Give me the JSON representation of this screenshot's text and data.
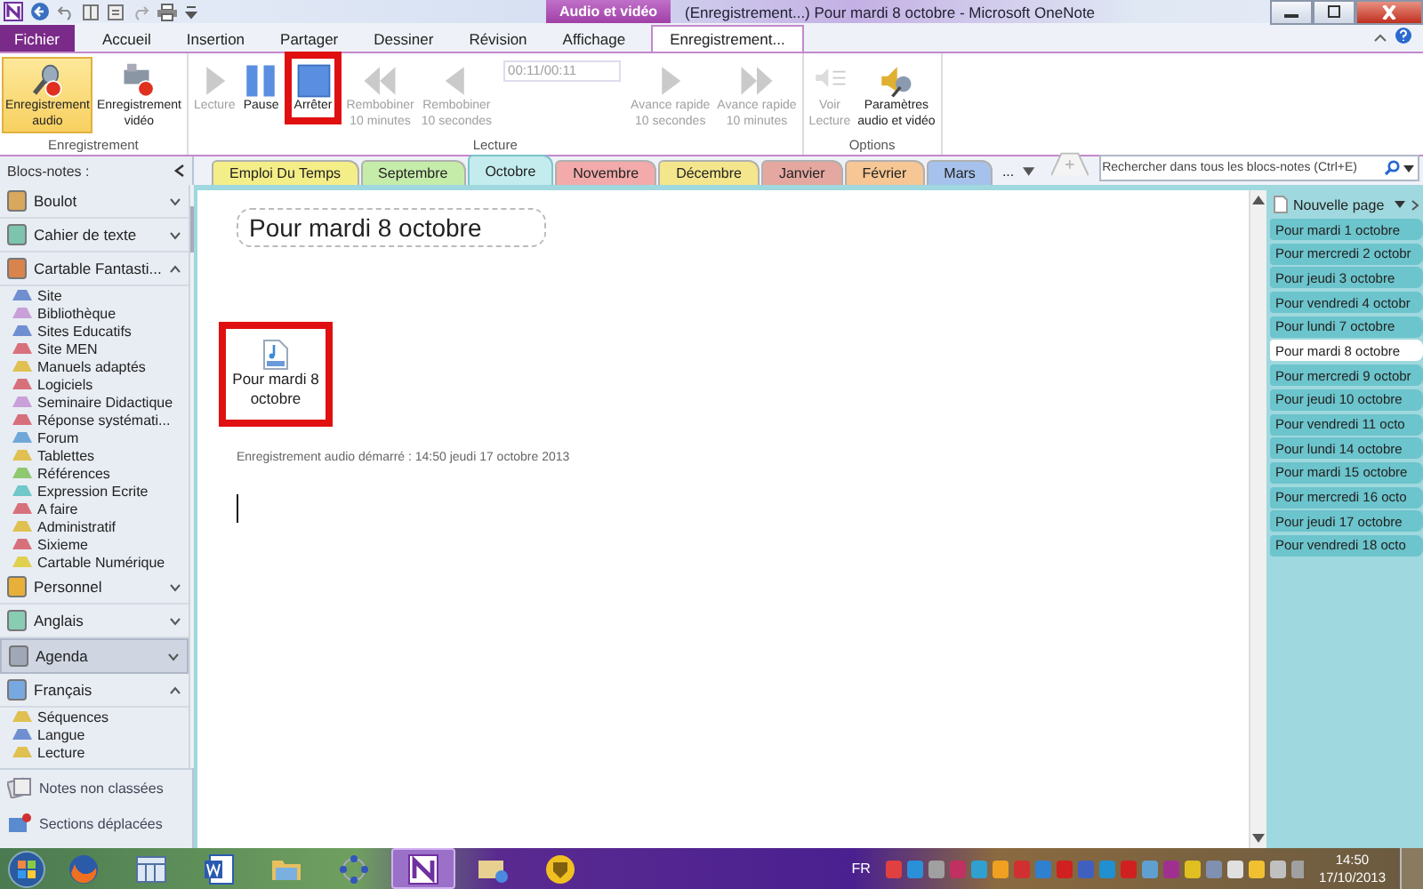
{
  "window": {
    "title": "(Enregistrement...) Pour mardi 8 octobre  -  Microsoft OneNote",
    "context_label": "Audio et vidéo"
  },
  "ribbon_tabs": [
    {
      "label": "Fichier",
      "kind": "file",
      "selected": false
    },
    {
      "label": "Accueil",
      "kind": "tab",
      "selected": false
    },
    {
      "label": "Insertion",
      "kind": "tab",
      "selected": false
    },
    {
      "label": "Partager",
      "kind": "tab",
      "selected": false
    },
    {
      "label": "Dessiner",
      "kind": "tab",
      "selected": false
    },
    {
      "label": "Révision",
      "kind": "tab",
      "selected": false
    },
    {
      "label": "Affichage",
      "kind": "tab",
      "selected": false
    },
    {
      "label": "Enregistrement...",
      "kind": "context",
      "selected": true
    }
  ],
  "ribbon_groups": [
    {
      "label": "Enregistrement",
      "buttons": [
        {
          "kind": "record-audio",
          "lines": [
            "Enregistrement",
            "audio"
          ],
          "disabled": false,
          "selected": true,
          "highlighted": false
        },
        {
          "kind": "record-video",
          "lines": [
            "Enregistrement",
            "vidéo"
          ],
          "disabled": false,
          "selected": false,
          "highlighted": false
        }
      ]
    },
    {
      "label": "Lecture",
      "time": "00:11/00:11",
      "buttons": [
        {
          "kind": "play",
          "lines": [
            "Lecture"
          ],
          "disabled": true,
          "selected": false,
          "highlighted": false
        },
        {
          "kind": "pause",
          "lines": [
            "Pause"
          ],
          "disabled": false,
          "selected": false,
          "highlighted": false
        },
        {
          "kind": "stop",
          "lines": [
            "Arrêter"
          ],
          "disabled": false,
          "selected": false,
          "highlighted": true
        },
        {
          "kind": "rewind-fast",
          "lines": [
            "Rembobiner",
            "10 minutes"
          ],
          "disabled": true,
          "selected": false,
          "highlighted": false
        },
        {
          "kind": "rewind",
          "lines": [
            "Rembobiner",
            "10 secondes"
          ],
          "disabled": true,
          "selected": false,
          "highlighted": false
        },
        {
          "kind": "time"
        },
        {
          "kind": "forward",
          "lines": [
            "Avance rapide",
            "10 secondes"
          ],
          "disabled": true,
          "selected": false,
          "highlighted": false
        },
        {
          "kind": "forward-fast",
          "lines": [
            "Avance rapide",
            "10 minutes"
          ],
          "disabled": true,
          "selected": false,
          "highlighted": false
        }
      ]
    },
    {
      "label": "Options",
      "buttons": [
        {
          "kind": "view",
          "lines": [
            "Voir",
            "Lecture"
          ],
          "disabled": true,
          "selected": false,
          "highlighted": false
        },
        {
          "kind": "settings",
          "lines": [
            "Paramètres",
            "audio et vidéo"
          ],
          "disabled": false,
          "selected": false,
          "highlighted": false
        }
      ]
    }
  ],
  "sidebar": {
    "title": "Blocs-notes :",
    "notebooks": [
      {
        "name": "Boulot",
        "color": "#d8a85c",
        "expanded": false,
        "selected": false
      },
      {
        "name": "Cahier de texte",
        "color": "#7cc4ae",
        "expanded": false,
        "selected": false
      },
      {
        "name": "Cartable Fantasti...",
        "color": "#d9844c",
        "expanded": true,
        "selected": false,
        "sections": [
          {
            "name": "Site",
            "color": "#6f8fd0"
          },
          {
            "name": "Bibliothèque",
            "color": "#c9a0d8"
          },
          {
            "name": "Sites Educatifs",
            "color": "#6f8fd0"
          },
          {
            "name": "Site MEN",
            "color": "#d8707c"
          },
          {
            "name": "Manuels adaptés",
            "color": "#e0c050"
          },
          {
            "name": "Logiciels",
            "color": "#d8707c"
          },
          {
            "name": "Seminaire Didactique",
            "color": "#c9a0d8"
          },
          {
            "name": "Réponse systémati...",
            "color": "#d8707c"
          },
          {
            "name": "Forum",
            "color": "#6fa8d8"
          },
          {
            "name": "Tablettes",
            "color": "#e0c050"
          },
          {
            "name": "Références",
            "color": "#90c870"
          },
          {
            "name": "Expression Ecrite",
            "color": "#70c8c8"
          },
          {
            "name": "A faire",
            "color": "#d8707c"
          },
          {
            "name": "Administratif",
            "color": "#e0c050"
          },
          {
            "name": "Sixieme",
            "color": "#d8707c"
          },
          {
            "name": "Cartable Numérique",
            "color": "#e0d050"
          }
        ]
      },
      {
        "name": "Personnel",
        "color": "#e8b038",
        "expanded": false,
        "selected": false
      },
      {
        "name": "Anglais",
        "color": "#88ccb4",
        "expanded": false,
        "selected": false
      },
      {
        "name": "Agenda",
        "color": "#a0a8b8",
        "expanded": false,
        "selected": true
      },
      {
        "name": "Français",
        "color": "#78a8e0",
        "expanded": true,
        "selected": false,
        "sections": [
          {
            "name": "Séquences",
            "color": "#e0c050"
          },
          {
            "name": "Langue",
            "color": "#6f8fd0"
          },
          {
            "name": "Lecture",
            "color": "#e0c050"
          }
        ]
      }
    ],
    "footer": [
      {
        "label": "Notes non classées",
        "kind": "unfiled"
      },
      {
        "label": "Sections déplacées",
        "kind": "misplaced"
      }
    ]
  },
  "section_tabs": [
    {
      "label": "Emploi Du Temps",
      "color": "#f4ee88",
      "selected": false
    },
    {
      "label": "Septembre",
      "color": "#c6ecaa",
      "selected": false
    },
    {
      "label": "Octobre",
      "color": "#c4ecee",
      "selected": true
    },
    {
      "label": "Novembre",
      "color": "#f2aaaa",
      "selected": false
    },
    {
      "label": "Décembre",
      "color": "#f4e68c",
      "selected": false
    },
    {
      "label": "Janvier",
      "color": "#e4a8a0",
      "selected": false
    },
    {
      "label": "Février",
      "color": "#f6c694",
      "selected": false
    },
    {
      "label": "Mars",
      "color": "#a6c2ec",
      "selected": false
    }
  ],
  "more_tabs": "...",
  "search": {
    "placeholder": "Rechercher dans tous les blocs-notes (Ctrl+E)"
  },
  "page": {
    "title": "Pour mardi 8 octobre",
    "attachment": {
      "name": "Pour mardi 8 octobre",
      "highlighted": true
    },
    "note": "Enregistrement audio démarré : 14:50 jeudi 17 octobre 2013"
  },
  "pages": {
    "new_page": "Nouvelle page",
    "items": [
      {
        "title": "Pour mardi 1 octobre",
        "selected": false
      },
      {
        "title": "Pour mercredi 2 octobr",
        "selected": false
      },
      {
        "title": "Pour jeudi 3 octobre",
        "selected": false
      },
      {
        "title": "Pour vendredi 4 octobr",
        "selected": false
      },
      {
        "title": "Pour lundi 7 octobre",
        "selected": false
      },
      {
        "title": "Pour mardi 8 octobre",
        "selected": true
      },
      {
        "title": "Pour mercredi 9 octobr",
        "selected": false
      },
      {
        "title": "Pour jeudi 10 octobre",
        "selected": false
      },
      {
        "title": "Pour vendredi 11 octo",
        "selected": false
      },
      {
        "title": "Pour lundi 14 octobre",
        "selected": false
      },
      {
        "title": "Pour mardi 15 octobre",
        "selected": false
      },
      {
        "title": "Pour mercredi 16 octo",
        "selected": false
      },
      {
        "title": "Pour jeudi 17 octobre",
        "selected": false
      },
      {
        "title": "Pour vendredi 18 octo",
        "selected": false
      }
    ]
  },
  "taskbar": {
    "apps": [
      {
        "kind": "browser",
        "active": false
      },
      {
        "kind": "calendar",
        "active": false
      },
      {
        "kind": "word",
        "active": false
      },
      {
        "kind": "folder",
        "active": false
      },
      {
        "kind": "network",
        "active": false
      },
      {
        "kind": "onenote",
        "active": true
      },
      {
        "kind": "mail",
        "active": false
      },
      {
        "kind": "shield",
        "active": false
      }
    ],
    "language": "FR",
    "time": "14:50",
    "date": "17/10/2013"
  }
}
